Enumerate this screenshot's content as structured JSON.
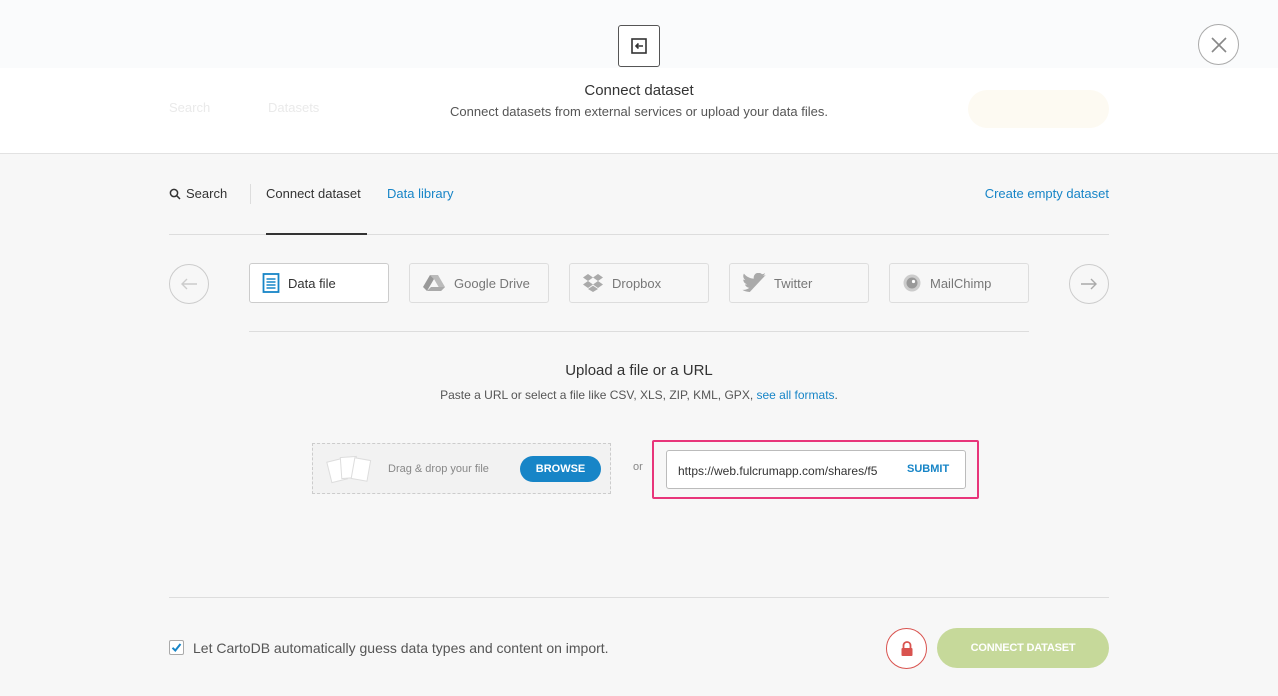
{
  "background_ghost": {
    "items": [
      "Search",
      "Datasets"
    ]
  },
  "header": {
    "title": "Connect dataset",
    "subtitle": "Connect datasets from external services or upload your data files."
  },
  "nav": {
    "search_label": "Search",
    "connect_label": "Connect dataset",
    "library_label": "Data library",
    "create_label": "Create empty dataset"
  },
  "services": [
    {
      "label": "Data file",
      "icon": "document-icon",
      "active": true
    },
    {
      "label": "Google Drive",
      "icon": "google-drive-icon",
      "active": false
    },
    {
      "label": "Dropbox",
      "icon": "dropbox-icon",
      "active": false
    },
    {
      "label": "Twitter",
      "icon": "twitter-icon",
      "active": false
    },
    {
      "label": "MailChimp",
      "icon": "mailchimp-icon",
      "active": false
    }
  ],
  "upload": {
    "title": "Upload a file or a URL",
    "desc_prefix": "Paste a URL or select a file like CSV, XLS, ZIP, KML, GPX,",
    "desc_link": "see all formats",
    "desc_suffix": ".",
    "drop_text": "Drag & drop your file",
    "browse_label": "BROWSE",
    "or_label": "or",
    "url_value": "https://web.fulcrumapp.com/shares/f5",
    "submit_label": "SUBMIT"
  },
  "footer": {
    "checkbox_checked": true,
    "checkbox_label": "Let CartoDB automatically guess data types and content on import.",
    "connect_label": "CONNECT DATASET"
  },
  "colors": {
    "link": "#1785c7",
    "highlight": "#e8357a",
    "connect_disabled": "#c6d99a",
    "lock": "#d9534f"
  }
}
